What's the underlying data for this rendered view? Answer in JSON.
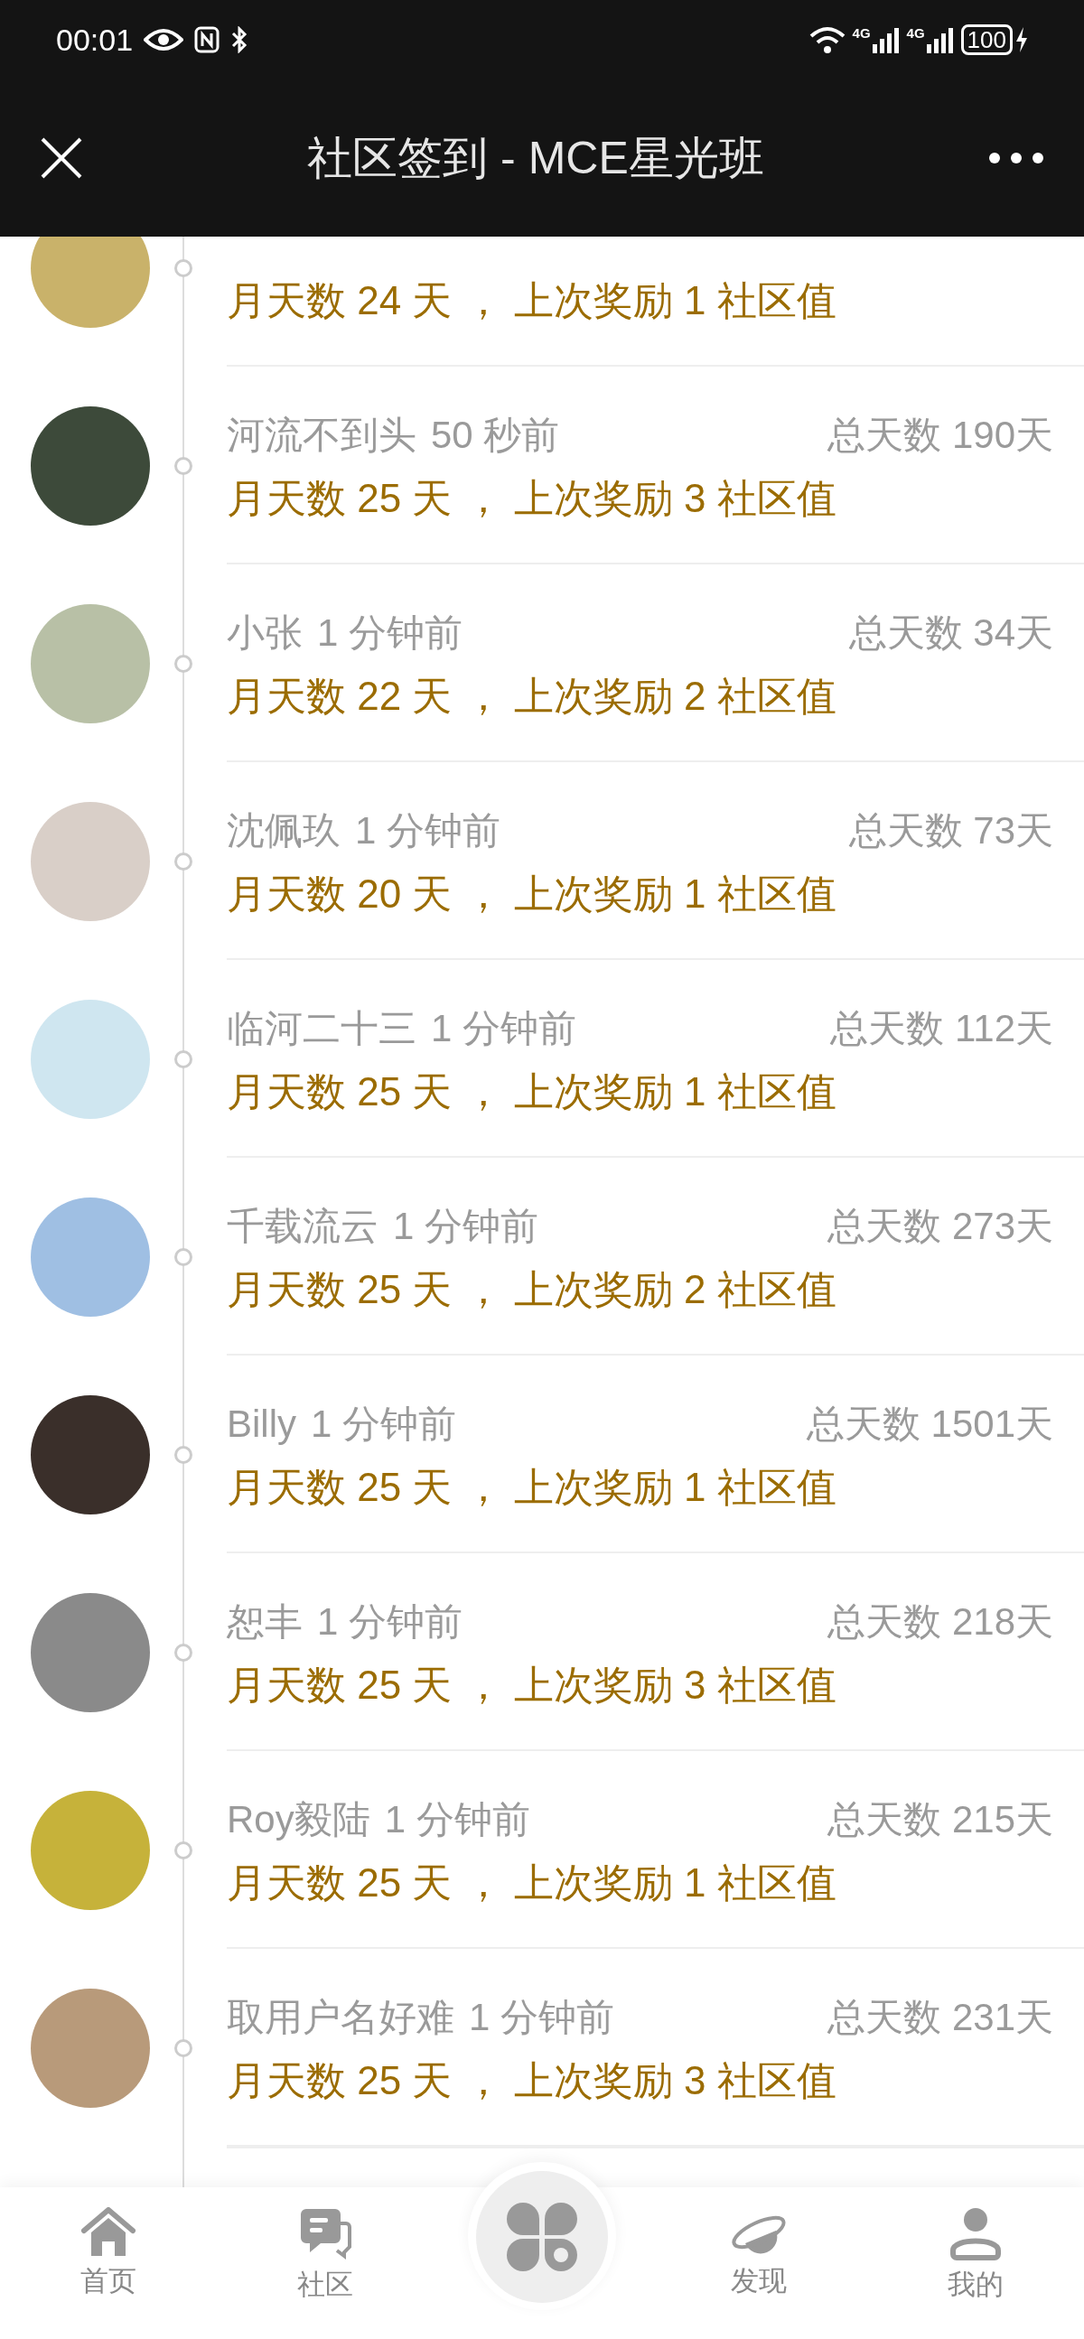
{
  "status_bar": {
    "time": "00:01",
    "networks": [
      "4G",
      "4G"
    ],
    "battery": "100"
  },
  "header": {
    "title": "社区签到 - MCE星光班"
  },
  "checkins": [
    {
      "detail": "月天数 24 天 ， 上次奖励 1 社区值"
    },
    {
      "name": "河流不到头",
      "time": "50 秒前",
      "total": "总天数 190天",
      "detail": "月天数 25 天 ， 上次奖励 3 社区值"
    },
    {
      "name": "小张",
      "time": "1 分钟前",
      "total": "总天数 34天",
      "detail": "月天数 22 天 ， 上次奖励 2 社区值"
    },
    {
      "name": "沈佩玖",
      "time": "1 分钟前",
      "total": "总天数 73天",
      "detail": "月天数 20 天 ， 上次奖励 1 社区值"
    },
    {
      "name": "临河二十三",
      "time": "1 分钟前",
      "total": "总天数 112天",
      "detail": "月天数 25 天 ， 上次奖励 1 社区值"
    },
    {
      "name": "千载流云",
      "time": "1 分钟前",
      "total": "总天数 273天",
      "detail": "月天数 25 天 ， 上次奖励 2 社区值"
    },
    {
      "name": "Billy",
      "time": "1 分钟前",
      "total": "总天数 1501天",
      "detail": "月天数 25 天 ， 上次奖励 1 社区值"
    },
    {
      "name": "恕丰",
      "time": "1 分钟前",
      "total": "总天数 218天",
      "detail": "月天数 25 天 ， 上次奖励 3 社区值"
    },
    {
      "name": "Roy毅陆",
      "time": "1 分钟前",
      "total": "总天数 215天",
      "detail": "月天数 25 天 ， 上次奖励 1 社区值"
    },
    {
      "name": "取用户名好难",
      "time": "1 分钟前",
      "total": "总天数 231天",
      "detail": "月天数 25 天 ， 上次奖励 3 社区值"
    }
  ],
  "tab_bar": [
    {
      "kind": "home",
      "label": "首页"
    },
    {
      "kind": "community",
      "label": "社区"
    },
    {
      "kind": "center"
    },
    {
      "kind": "discover",
      "label": "发现"
    },
    {
      "kind": "me",
      "label": "我的"
    }
  ]
}
